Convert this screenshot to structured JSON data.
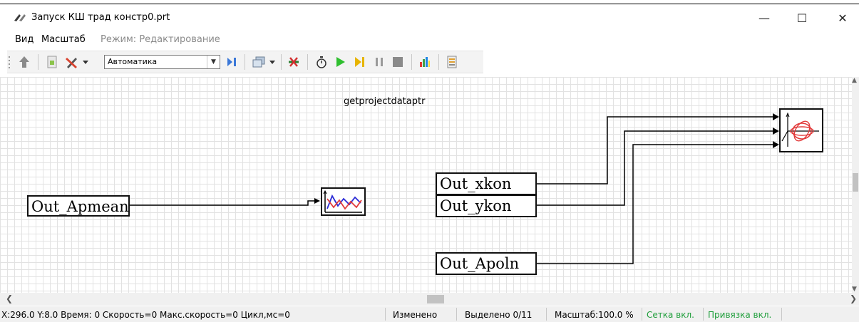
{
  "window": {
    "title": "Запуск КШ трад констр0.prt",
    "minimize_glyph": "—",
    "maximize_glyph": "☐",
    "close_glyph": "✕"
  },
  "menu": {
    "items": [
      "Вид",
      "Масштаб"
    ],
    "mode_label": "Режим: Редактирование"
  },
  "toolbar": {
    "mode_select": {
      "value": "Автоматика"
    },
    "icons": [
      "arrow-up-icon",
      "script-icon",
      "tools-icon",
      "dropdown-arrow-icon",
      "step-into-icon",
      "layers-icon",
      "dropdown-arrow-icon",
      "remove-links-icon",
      "timer-icon",
      "play-icon",
      "step-icon",
      "pause-icon",
      "stop-icon",
      "bar-chart-icon",
      "export-icon"
    ],
    "colors": {
      "play": "#2fbf2f",
      "step": "#e7b400",
      "pause": "#9a9a9a",
      "stop": "#8a8a8a"
    }
  },
  "canvas": {
    "caption": "getprojectdataptr",
    "blocks": [
      "Out_Apmean",
      "Out_xkon",
      "Out_ykon",
      "Out_Apoln"
    ],
    "plot_blocks": [
      "line-plot-icon",
      "phase-portrait-icon"
    ],
    "colors": {
      "plot_series_1": "#2b2bd6",
      "plot_series_2": "#e23b3b",
      "grid": "#e2e2e2",
      "wire": "#000000"
    }
  },
  "status": {
    "coords": "X:296.0  Y:8.0 Время: 0 Скорость=0 Макс.скорость=0 Цикл,мс=0",
    "modified": "Изменено",
    "selected": "Выделено 0/11",
    "scale": "Масштаб:100.0 %",
    "grid": "Сетка вкл.",
    "snap": "Привязка вкл.",
    "colors": {
      "on_state": "#1f9e3b"
    }
  }
}
